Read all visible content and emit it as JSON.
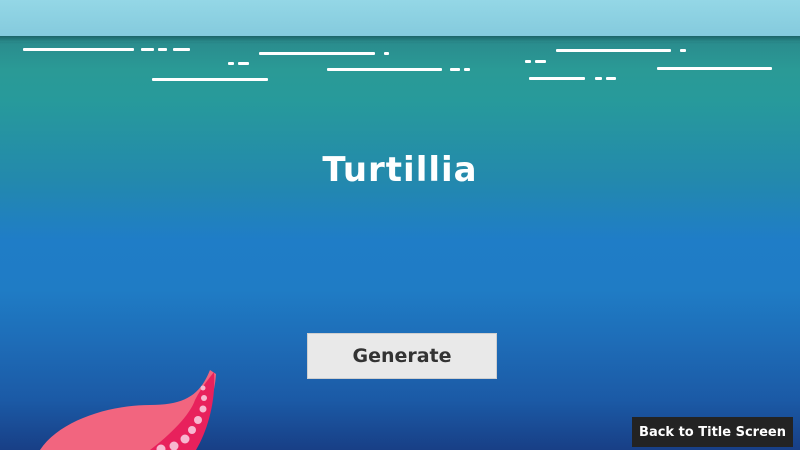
{
  "game": {
    "title": "Turtillia"
  },
  "buttons": {
    "generate_label": "Generate",
    "back_label": "Back to Title Screen"
  },
  "colors": {
    "sky": "#8fd3e3",
    "ocean_top": "#2a9a96",
    "ocean_mid": "#1f7dc7",
    "ocean_bottom": "#183f86",
    "button_light": "#e9e9e9",
    "button_dark": "#232323",
    "tentacle_light": "#f2657f",
    "tentacle_dark": "#e8215c",
    "sucker": "#f7b8d0"
  },
  "icons": {
    "decoration": "tentacle-icon"
  }
}
